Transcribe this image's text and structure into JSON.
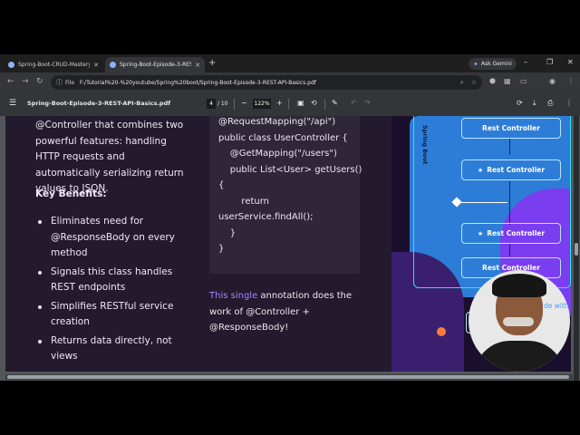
{
  "browser": {
    "tabs": [
      {
        "label": "Spring-Boot-CRUD-Mastery-YouTu",
        "active": false
      },
      {
        "label": "Spring-Boot-Episode-3-REST-API-",
        "active": true
      }
    ],
    "new_tab": "+",
    "gemini_label": "Ask Gemini",
    "window_controls": {
      "minimize": "–",
      "maximize": "❐",
      "close": "✕"
    },
    "file_tag": "File",
    "url": "F:/Tutorial%20-%20youtube/Spring%20boot/Spring-Boot-Episode-3-REST-API-Basics.pdf"
  },
  "pdf_toolbar": {
    "doc_name": "Spring-Boot-Episode-3-REST-API-Basics.pdf",
    "current_page": "4",
    "total_pages": "/ 10",
    "zoom": "122%",
    "zoom_out": "−",
    "zoom_in": "+"
  },
  "page": {
    "intro_text": "@Controller that combines two powerful features: handling HTTP requests and automatically serializing return values to JSON.",
    "benefits_heading": "Key Benefits:",
    "benefits": [
      "Eliminates need for @ResponseBody on every method",
      "Signals this class handles REST endpoints",
      "Simplifies RESTful service creation",
      "Returns data directly, not views"
    ],
    "code_lines": [
      "@RequestMapping(\"/api\")",
      "public class UserController {",
      "",
      "    @GetMapping(\"/users\")",
      "    public List<User> getUsers()",
      "{",
      "        return",
      "userService.findAll();",
      "    }",
      "}"
    ],
    "note_highlight": "This single",
    "note_rest": " annotation does the work of @Controller + @ResponseBody!"
  },
  "illustration": {
    "vertical_label": "Spring Boot",
    "boxes": [
      {
        "label": "Rest Controller",
        "star": false
      },
      {
        "label": "Rest Controller",
        "star": true
      },
      {
        "label": "Rest Controller",
        "star": true
      },
      {
        "label": "Rest Controller",
        "star": false
      }
    ],
    "star_glyph": "★"
  },
  "webcam": {
    "caption": "de with"
  },
  "colors": {
    "page_bg": "#241a2e",
    "code_bg": "#2f2638",
    "accent_blue": "#2d7dd8",
    "accent_purple": "#7a3df0",
    "cyan_border": "#2fe0f0",
    "highlight": "#9d8cff"
  }
}
